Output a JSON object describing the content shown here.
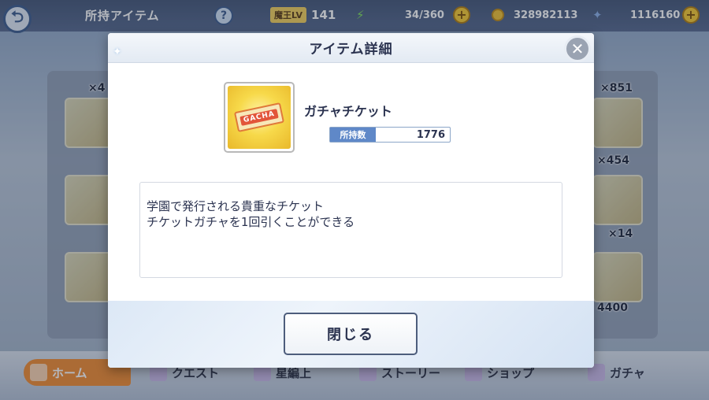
{
  "topbar": {
    "title": "所持アイテム",
    "help_symbol": "?",
    "level_label": "魔王LV",
    "level_value": "141",
    "stamina": "34/360",
    "gold": "328982113",
    "stones": "1116160"
  },
  "background_items": {
    "counts": [
      "×4",
      "×",
      "×",
      "×",
      "×851",
      "×454",
      "×14",
      "4400"
    ]
  },
  "navbar": {
    "home": "ホーム",
    "quest": "クエスト",
    "training": "星編上",
    "story": "ストーリー",
    "shop": "ショップ",
    "gacha": "ガチャ"
  },
  "dialog": {
    "title": "アイテム詳細",
    "item_name": "ガチャチケット",
    "ticket_text": "GACHA",
    "owned_label": "所持数",
    "owned_value": "1776",
    "description_lines": [
      "学園で発行される貴重なチケット",
      "チケットガチャを1回引くことができる"
    ],
    "close_label": "閉じる"
  },
  "colors": {
    "accent_orange": "#f28a2e",
    "owned_label_bg": "#5f88c8",
    "item_bg_yellow": "#f7d94a"
  },
  "icons": {
    "back": "back-arrow-icon",
    "help": "question-icon",
    "close": "close-x-icon",
    "stamina": "lightning-bolt-icon",
    "gold": "coin-icon",
    "stone": "star-gem-icon"
  }
}
